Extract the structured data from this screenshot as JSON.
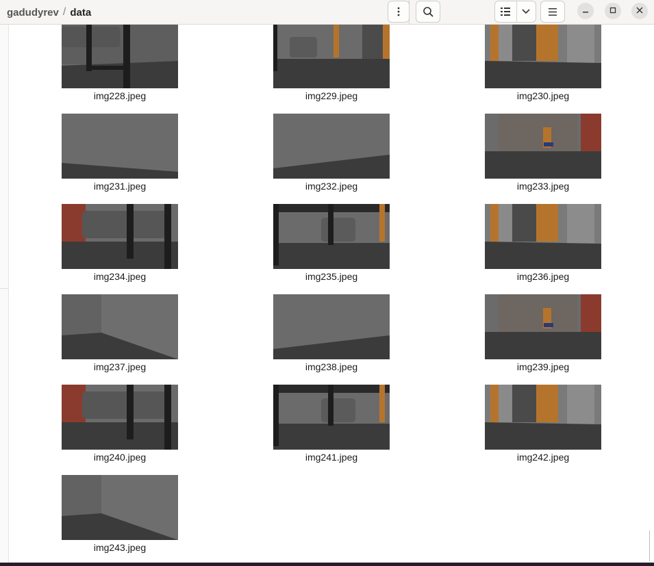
{
  "window": {
    "path": [
      "gadudyrev",
      "data"
    ],
    "path_separator": "/"
  },
  "toolbar": {
    "menu_icon": "kebab-menu-icon",
    "search_icon": "search-icon",
    "view_icon": "list-view-icon",
    "view_dropdown_icon": "chevron-down-icon",
    "main_menu_icon": "hamburger-menu-icon"
  },
  "files": [
    {
      "name": "img228.jpeg",
      "scene": "table-sofa"
    },
    {
      "name": "img229.jpeg",
      "scene": "chair-door"
    },
    {
      "name": "img230.jpeg",
      "scene": "hall-doors"
    },
    {
      "name": "img231.jpeg",
      "scene": "plain-wall"
    },
    {
      "name": "img232.jpeg",
      "scene": "plain-wall-b"
    },
    {
      "name": "img233.jpeg",
      "scene": "brick-door"
    },
    {
      "name": "img234.jpeg",
      "scene": "brick-sofa"
    },
    {
      "name": "img235.jpeg",
      "scene": "table-chair"
    },
    {
      "name": "img236.jpeg",
      "scene": "hall-doors-b"
    },
    {
      "name": "img237.jpeg",
      "scene": "wall-corner"
    },
    {
      "name": "img238.jpeg",
      "scene": "plain-wall-b"
    },
    {
      "name": "img239.jpeg",
      "scene": "door-robot"
    },
    {
      "name": "img240.jpeg",
      "scene": "brick-sofa-b"
    },
    {
      "name": "img241.jpeg",
      "scene": "table-chair-b"
    },
    {
      "name": "img242.jpeg",
      "scene": "hall-doors-c"
    },
    {
      "name": "img243.jpeg",
      "scene": "wall-corner-b"
    }
  ],
  "colors": {
    "floor": "#3b3b3b",
    "wall": "#6b6b6b",
    "brick": "#8a3b2e",
    "wood": "#b5742c"
  }
}
